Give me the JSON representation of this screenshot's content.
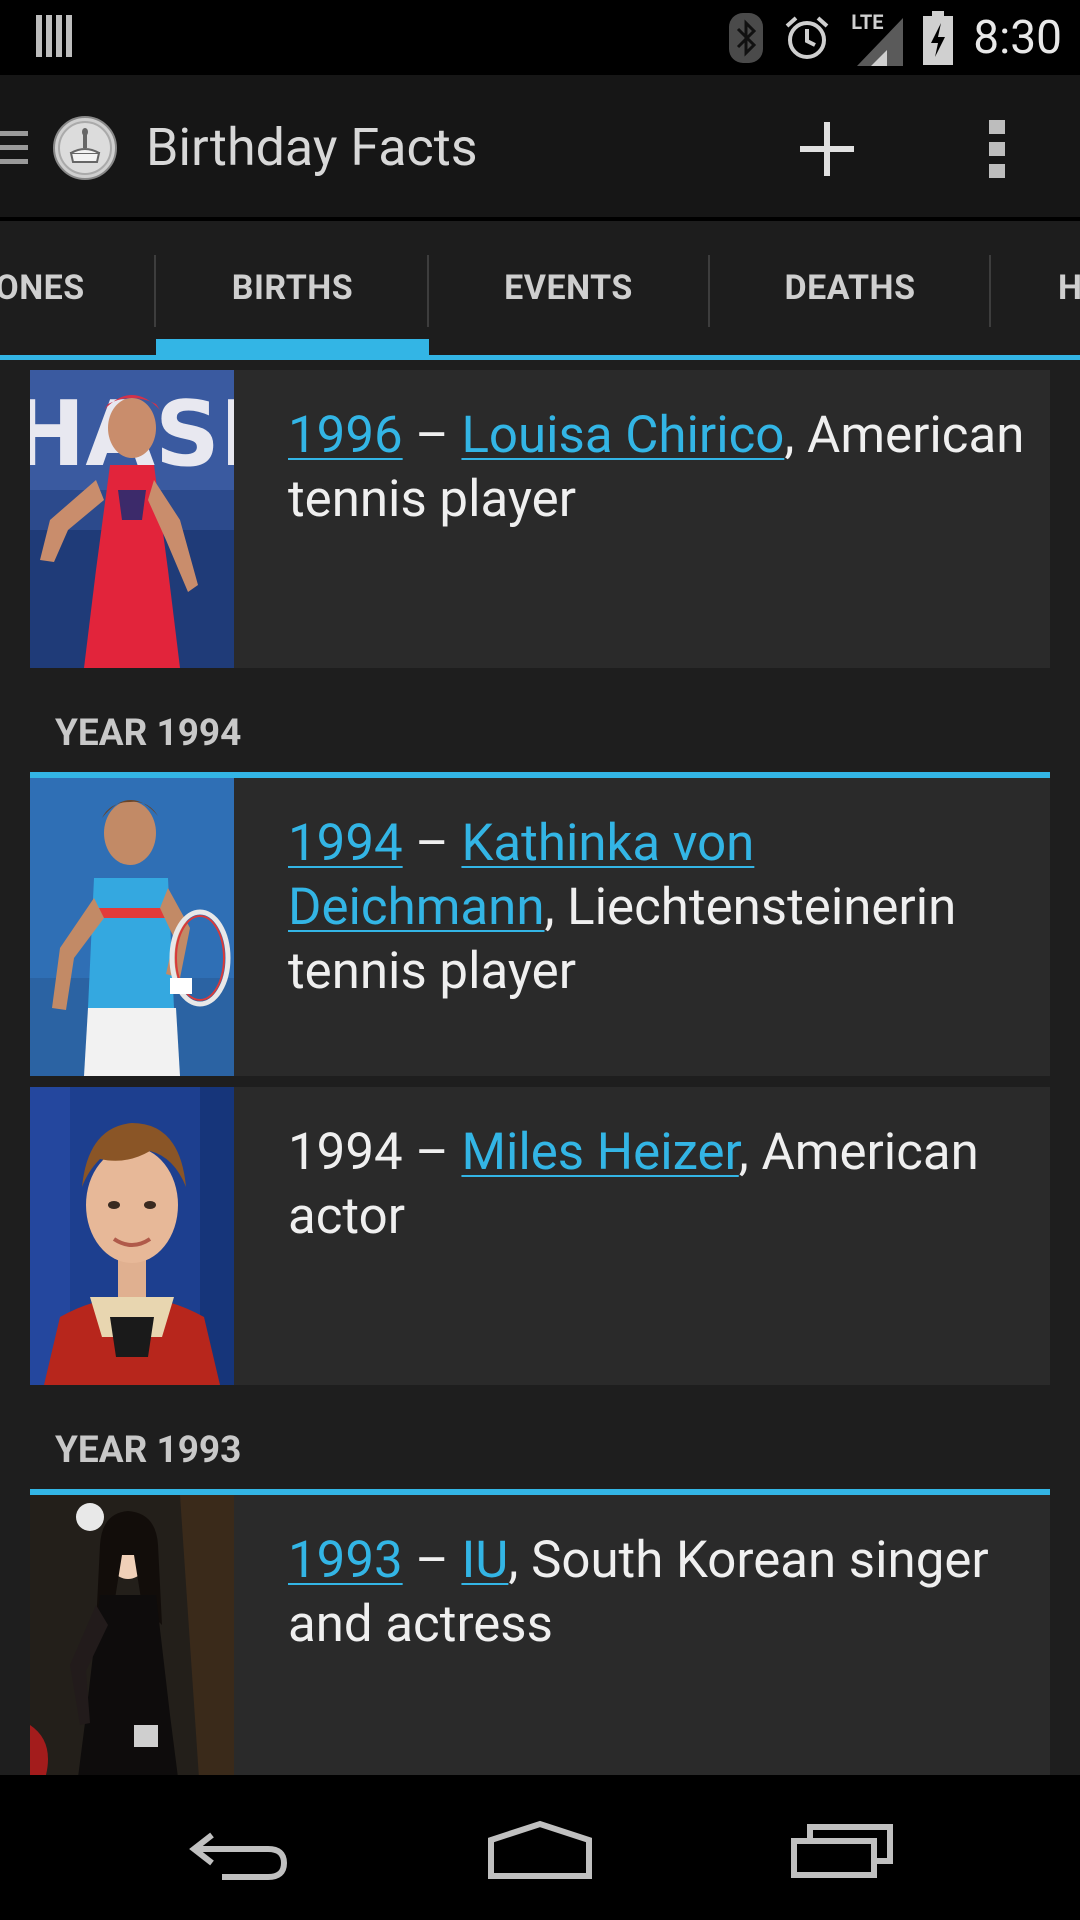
{
  "status_bar": {
    "time": "8:30",
    "network": "LTE",
    "icons": [
      "notification-bars-icon",
      "bluetooth-icon",
      "alarm-icon",
      "signal-icon",
      "battery-charging-icon"
    ]
  },
  "app_bar": {
    "title": "Birthday Facts",
    "icons": [
      "drawer-icon",
      "cake-logo-icon",
      "add-icon",
      "overflow-menu-icon"
    ]
  },
  "tabs": [
    {
      "label": "ONES",
      "selected": false
    },
    {
      "label": "BIRTHS",
      "selected": true
    },
    {
      "label": "EVENTS",
      "selected": false
    },
    {
      "label": "DEATHS",
      "selected": false
    },
    {
      "label": "H",
      "selected": false
    }
  ],
  "colors": {
    "accent": "#33b5e5",
    "card": "#2a2a2a",
    "background": "#1e1e1e"
  },
  "sections": [
    {
      "header": "",
      "entries": [
        {
          "year": "1996",
          "year_linked": true,
          "sep": " – ",
          "name": "Louisa Chirico",
          "desc": ", American tennis player",
          "image": "tennis-player-red-dress-photo"
        }
      ]
    },
    {
      "header": "YEAR 1994",
      "entries": [
        {
          "year": "1994",
          "year_linked": true,
          "sep": " – ",
          "name": "Kathinka von Deichmann",
          "desc": ", Liechtensteinerin tennis player",
          "image": "tennis-player-blue-shirt-photo"
        },
        {
          "year": "1994",
          "year_linked": false,
          "sep": " – ",
          "name": "Miles Heizer",
          "desc": ", American actor",
          "image": "actor-portrait-photo"
        }
      ]
    },
    {
      "header": "YEAR 1993",
      "entries": [
        {
          "year": "1993",
          "year_linked": true,
          "sep": " – ",
          "name": "IU",
          "desc": ", South Korean singer and actress",
          "image": "singer-black-dress-photo"
        }
      ]
    }
  ],
  "nav_bar": {
    "icons": [
      "back-icon",
      "home-icon",
      "recents-icon"
    ]
  }
}
